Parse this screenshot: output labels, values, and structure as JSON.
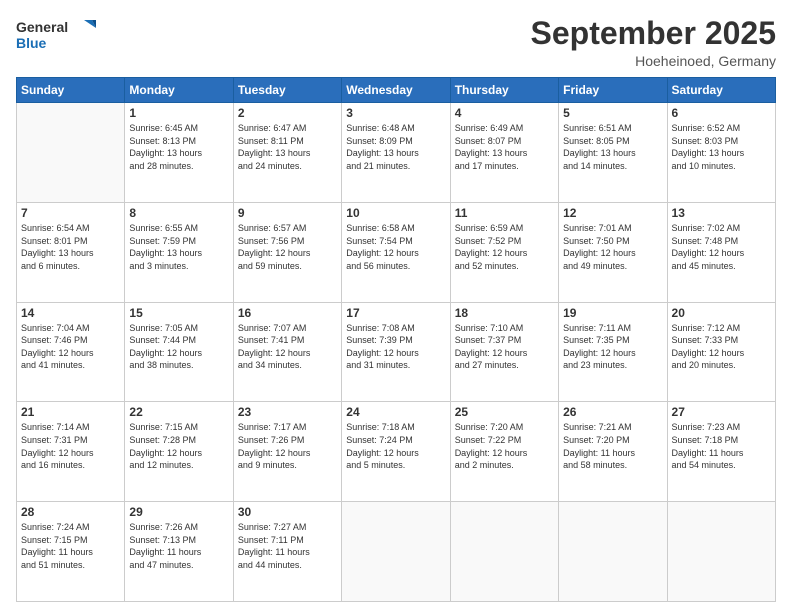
{
  "header": {
    "logo_general": "General",
    "logo_blue": "Blue",
    "month": "September 2025",
    "location": "Hoeheinoed, Germany"
  },
  "days_of_week": [
    "Sunday",
    "Monday",
    "Tuesday",
    "Wednesday",
    "Thursday",
    "Friday",
    "Saturday"
  ],
  "weeks": [
    [
      {
        "day": "",
        "info": ""
      },
      {
        "day": "1",
        "info": "Sunrise: 6:45 AM\nSunset: 8:13 PM\nDaylight: 13 hours\nand 28 minutes."
      },
      {
        "day": "2",
        "info": "Sunrise: 6:47 AM\nSunset: 8:11 PM\nDaylight: 13 hours\nand 24 minutes."
      },
      {
        "day": "3",
        "info": "Sunrise: 6:48 AM\nSunset: 8:09 PM\nDaylight: 13 hours\nand 21 minutes."
      },
      {
        "day": "4",
        "info": "Sunrise: 6:49 AM\nSunset: 8:07 PM\nDaylight: 13 hours\nand 17 minutes."
      },
      {
        "day": "5",
        "info": "Sunrise: 6:51 AM\nSunset: 8:05 PM\nDaylight: 13 hours\nand 14 minutes."
      },
      {
        "day": "6",
        "info": "Sunrise: 6:52 AM\nSunset: 8:03 PM\nDaylight: 13 hours\nand 10 minutes."
      }
    ],
    [
      {
        "day": "7",
        "info": "Sunrise: 6:54 AM\nSunset: 8:01 PM\nDaylight: 13 hours\nand 6 minutes."
      },
      {
        "day": "8",
        "info": "Sunrise: 6:55 AM\nSunset: 7:59 PM\nDaylight: 13 hours\nand 3 minutes."
      },
      {
        "day": "9",
        "info": "Sunrise: 6:57 AM\nSunset: 7:56 PM\nDaylight: 12 hours\nand 59 minutes."
      },
      {
        "day": "10",
        "info": "Sunrise: 6:58 AM\nSunset: 7:54 PM\nDaylight: 12 hours\nand 56 minutes."
      },
      {
        "day": "11",
        "info": "Sunrise: 6:59 AM\nSunset: 7:52 PM\nDaylight: 12 hours\nand 52 minutes."
      },
      {
        "day": "12",
        "info": "Sunrise: 7:01 AM\nSunset: 7:50 PM\nDaylight: 12 hours\nand 49 minutes."
      },
      {
        "day": "13",
        "info": "Sunrise: 7:02 AM\nSunset: 7:48 PM\nDaylight: 12 hours\nand 45 minutes."
      }
    ],
    [
      {
        "day": "14",
        "info": "Sunrise: 7:04 AM\nSunset: 7:46 PM\nDaylight: 12 hours\nand 41 minutes."
      },
      {
        "day": "15",
        "info": "Sunrise: 7:05 AM\nSunset: 7:44 PM\nDaylight: 12 hours\nand 38 minutes."
      },
      {
        "day": "16",
        "info": "Sunrise: 7:07 AM\nSunset: 7:41 PM\nDaylight: 12 hours\nand 34 minutes."
      },
      {
        "day": "17",
        "info": "Sunrise: 7:08 AM\nSunset: 7:39 PM\nDaylight: 12 hours\nand 31 minutes."
      },
      {
        "day": "18",
        "info": "Sunrise: 7:10 AM\nSunset: 7:37 PM\nDaylight: 12 hours\nand 27 minutes."
      },
      {
        "day": "19",
        "info": "Sunrise: 7:11 AM\nSunset: 7:35 PM\nDaylight: 12 hours\nand 23 minutes."
      },
      {
        "day": "20",
        "info": "Sunrise: 7:12 AM\nSunset: 7:33 PM\nDaylight: 12 hours\nand 20 minutes."
      }
    ],
    [
      {
        "day": "21",
        "info": "Sunrise: 7:14 AM\nSunset: 7:31 PM\nDaylight: 12 hours\nand 16 minutes."
      },
      {
        "day": "22",
        "info": "Sunrise: 7:15 AM\nSunset: 7:28 PM\nDaylight: 12 hours\nand 12 minutes."
      },
      {
        "day": "23",
        "info": "Sunrise: 7:17 AM\nSunset: 7:26 PM\nDaylight: 12 hours\nand 9 minutes."
      },
      {
        "day": "24",
        "info": "Sunrise: 7:18 AM\nSunset: 7:24 PM\nDaylight: 12 hours\nand 5 minutes."
      },
      {
        "day": "25",
        "info": "Sunrise: 7:20 AM\nSunset: 7:22 PM\nDaylight: 12 hours\nand 2 minutes."
      },
      {
        "day": "26",
        "info": "Sunrise: 7:21 AM\nSunset: 7:20 PM\nDaylight: 11 hours\nand 58 minutes."
      },
      {
        "day": "27",
        "info": "Sunrise: 7:23 AM\nSunset: 7:18 PM\nDaylight: 11 hours\nand 54 minutes."
      }
    ],
    [
      {
        "day": "28",
        "info": "Sunrise: 7:24 AM\nSunset: 7:15 PM\nDaylight: 11 hours\nand 51 minutes."
      },
      {
        "day": "29",
        "info": "Sunrise: 7:26 AM\nSunset: 7:13 PM\nDaylight: 11 hours\nand 47 minutes."
      },
      {
        "day": "30",
        "info": "Sunrise: 7:27 AM\nSunset: 7:11 PM\nDaylight: 11 hours\nand 44 minutes."
      },
      {
        "day": "",
        "info": ""
      },
      {
        "day": "",
        "info": ""
      },
      {
        "day": "",
        "info": ""
      },
      {
        "day": "",
        "info": ""
      }
    ]
  ]
}
